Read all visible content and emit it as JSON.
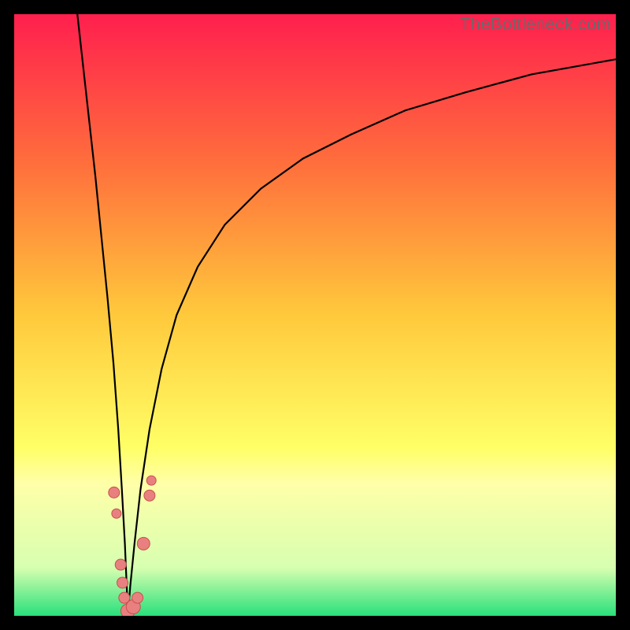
{
  "watermark": "TheBottleneck.com",
  "chart_data": {
    "type": "line",
    "title": "",
    "xlabel": "",
    "ylabel": "",
    "xlim": [
      0,
      100
    ],
    "ylim": [
      0,
      100
    ],
    "grid": false,
    "legend": false,
    "background_gradient": {
      "stops": [
        {
          "offset": 0.0,
          "color": "#ff1f4e"
        },
        {
          "offset": 0.25,
          "color": "#ff6f3c"
        },
        {
          "offset": 0.5,
          "color": "#ffc93c"
        },
        {
          "offset": 0.72,
          "color": "#ffff66"
        },
        {
          "offset": 0.78,
          "color": "#ffffa8"
        },
        {
          "offset": 0.92,
          "color": "#d7ffb0"
        },
        {
          "offset": 1.0,
          "color": "#29e07b"
        }
      ]
    },
    "series": [
      {
        "name": "left-branch",
        "x": [
          10.5,
          11.5,
          12.5,
          13.5,
          14.5,
          15.5,
          16.5,
          17.3,
          17.9,
          18.4,
          18.7,
          18.9
        ],
        "y": [
          100,
          91,
          82,
          73,
          63,
          53,
          42,
          31,
          21,
          12,
          5,
          0
        ]
      },
      {
        "name": "right-branch",
        "x": [
          18.9,
          19.3,
          20.0,
          21.0,
          22.5,
          24.5,
          27.0,
          30.5,
          35.0,
          41.0,
          48.0,
          56.0,
          65.0,
          75.0,
          86.0,
          100.0
        ],
        "y": [
          0,
          5,
          12,
          21,
          31,
          41,
          50,
          58,
          65,
          71,
          76,
          80,
          84,
          87,
          90,
          92.5
        ]
      }
    ],
    "scatter": {
      "name": "points",
      "fill": "#e98080",
      "stroke": "#c94f4f",
      "points": [
        {
          "x": 16.6,
          "y": 20.5,
          "r": 7
        },
        {
          "x": 17.0,
          "y": 17.0,
          "r": 6
        },
        {
          "x": 17.7,
          "y": 8.5,
          "r": 7
        },
        {
          "x": 18.0,
          "y": 5.5,
          "r": 7
        },
        {
          "x": 18.3,
          "y": 3.0,
          "r": 7
        },
        {
          "x": 18.9,
          "y": 0.8,
          "r": 9
        },
        {
          "x": 19.8,
          "y": 1.5,
          "r": 9
        },
        {
          "x": 20.5,
          "y": 3.0,
          "r": 7
        },
        {
          "x": 21.5,
          "y": 12.0,
          "r": 8
        },
        {
          "x": 22.5,
          "y": 20.0,
          "r": 7
        },
        {
          "x": 22.8,
          "y": 22.5,
          "r": 6
        }
      ]
    }
  }
}
